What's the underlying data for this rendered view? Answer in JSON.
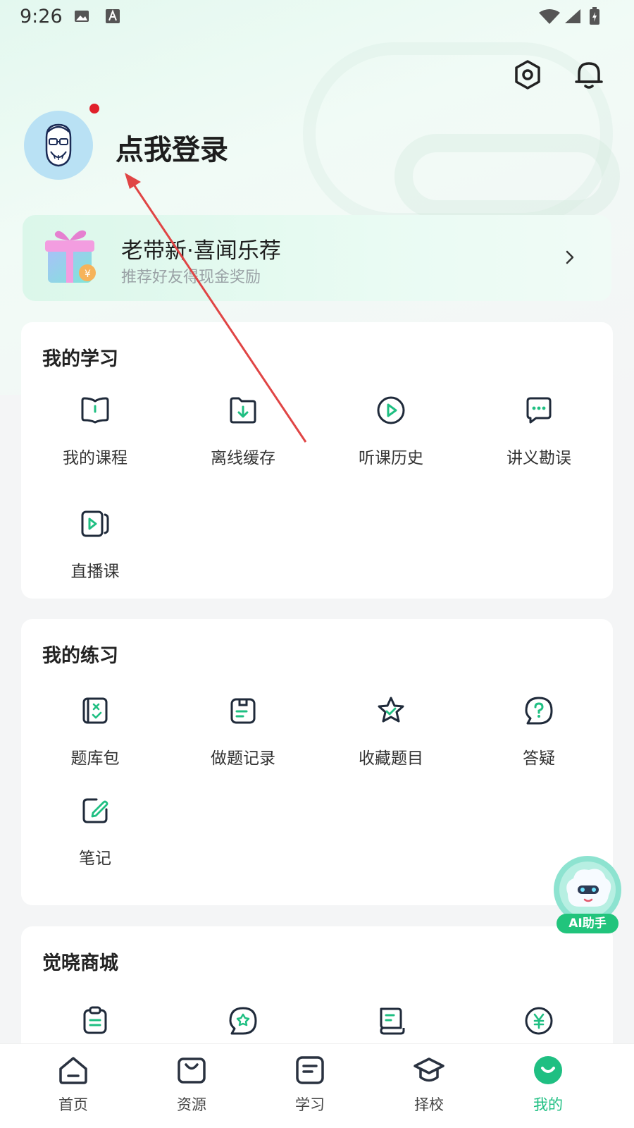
{
  "status_bar": {
    "time": "9:26"
  },
  "profile": {
    "login_label": "点我登录"
  },
  "referral": {
    "title": "老带新·喜闻乐荐",
    "subtitle": "推荐好友得现金奖励"
  },
  "study_section": {
    "title": "我的学习",
    "items": [
      {
        "label": "我的课程",
        "icon": "book-icon"
      },
      {
        "label": "离线缓存",
        "icon": "download-folder-icon"
      },
      {
        "label": "听课历史",
        "icon": "play-circle-icon"
      },
      {
        "label": "讲义勘误",
        "icon": "chat-dots-icon"
      },
      {
        "label": "直播课",
        "icon": "live-video-icon"
      }
    ]
  },
  "practice_section": {
    "title": "我的练习",
    "items": [
      {
        "label": "题库包",
        "icon": "question-bank-icon"
      },
      {
        "label": "做题记录",
        "icon": "record-icon"
      },
      {
        "label": "收藏题目",
        "icon": "star-icon"
      },
      {
        "label": "答疑",
        "icon": "question-bubble-icon"
      },
      {
        "label": "笔记",
        "icon": "note-edit-icon"
      }
    ]
  },
  "mall_section": {
    "title": "觉晓商城",
    "items": [
      {
        "icon": "clipboard-icon"
      },
      {
        "icon": "chat-badge-icon"
      },
      {
        "icon": "scroll-icon"
      },
      {
        "icon": "yen-coin-icon"
      }
    ]
  },
  "ai_helper": {
    "label": "AI助手"
  },
  "bottom_nav": {
    "items": [
      {
        "label": "首页",
        "icon": "home-icon"
      },
      {
        "label": "资源",
        "icon": "bag-icon"
      },
      {
        "label": "学习",
        "icon": "study-icon"
      },
      {
        "label": "择校",
        "icon": "graduation-cap-icon"
      },
      {
        "label": "我的",
        "icon": "profile-icon"
      }
    ],
    "active_index": 4
  },
  "colors": {
    "accent": "#1fbf82",
    "text_dark": "#1d1d1d",
    "annotation_arrow": "#e04545"
  }
}
